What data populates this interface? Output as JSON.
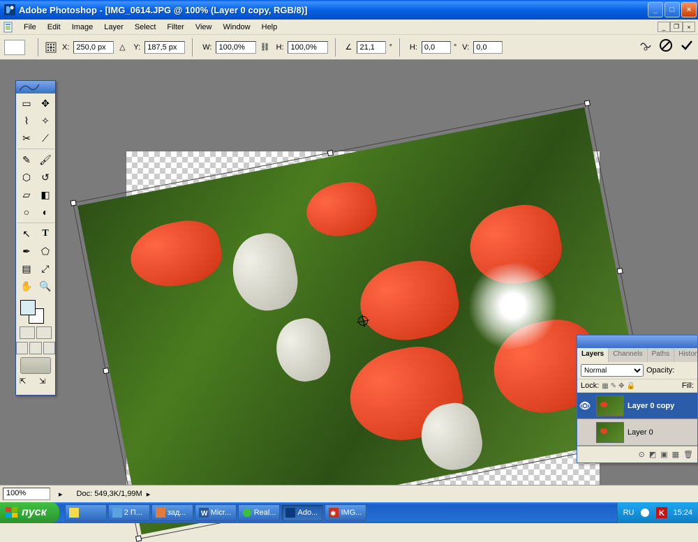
{
  "titlebar": {
    "title": "Adobe Photoshop - [IMG_0614.JPG @ 100% (Layer 0 copy, RGB/8)]"
  },
  "menu": {
    "items": [
      "File",
      "Edit",
      "Image",
      "Layer",
      "Select",
      "Filter",
      "View",
      "Window",
      "Help"
    ]
  },
  "options": {
    "x_label": "X:",
    "x_value": "250,0 px",
    "y_label": "Y:",
    "y_value": "187,5 px",
    "w_label": "W:",
    "w_value": "100,0%",
    "h_label": "H:",
    "h_value": "100,0%",
    "angle_label": "",
    "angle_value": "21,1",
    "angle_unit": "°",
    "hskew_label": "H:",
    "hskew_value": "0,0",
    "hskew_unit": "°",
    "vskew_label": "V:",
    "vskew_value": "0,0"
  },
  "layers_panel": {
    "tabs": [
      "Layers",
      "Channels",
      "Paths",
      "History"
    ],
    "blend_mode": "Normal",
    "opacity_label": "Opacity:",
    "lock_label": "Lock:",
    "fill_label": "Fill:",
    "layers": [
      {
        "name": "Layer 0 copy",
        "visible": true,
        "selected": true
      },
      {
        "name": "Layer 0",
        "visible": false,
        "selected": false
      }
    ]
  },
  "statusbar": {
    "zoom": "100%",
    "doc_label": "Doc:",
    "doc_size": "549,3K/1,99M"
  },
  "taskbar": {
    "start": "пуск",
    "items": [
      {
        "label": ""
      },
      {
        "label": "2 П..."
      },
      {
        "label": "зад..."
      },
      {
        "label": "Micr..."
      },
      {
        "label": "Real..."
      },
      {
        "label": "Ado...",
        "active": true
      },
      {
        "label": "IMG..."
      }
    ],
    "lang": "RU",
    "clock": "15:24"
  },
  "colors": {
    "accent": "#2A5CAA"
  }
}
